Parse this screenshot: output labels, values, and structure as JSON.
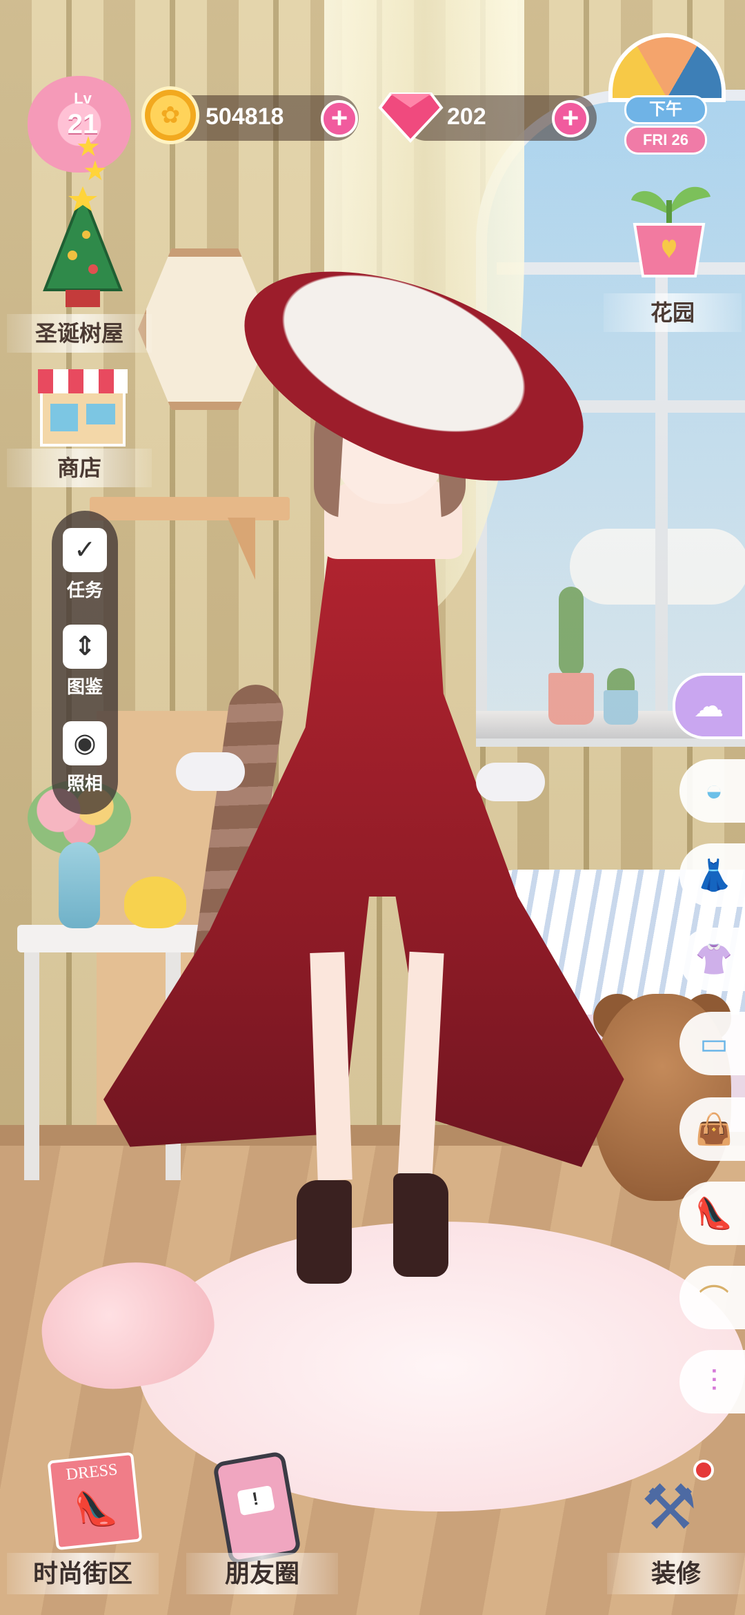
{
  "hud": {
    "level": {
      "label": "Lv",
      "value": "21"
    },
    "coins": {
      "value": "504818",
      "icon": "coin-icon",
      "add_label": "+"
    },
    "gems": {
      "value": "202",
      "icon": "diamond-icon",
      "add_label": "+"
    },
    "time_of_day": "下午",
    "date": "FRI 26"
  },
  "left_menu": {
    "christmas_house": "圣诞树屋",
    "shop": "商店"
  },
  "right_menu": {
    "garden": "花园"
  },
  "quick_bar": [
    {
      "label": "任务",
      "icon": "clipboard-icon"
    },
    {
      "label": "图鉴",
      "icon": "album-icon"
    },
    {
      "label": "照相",
      "icon": "camera-icon"
    }
  ],
  "category_tabs": [
    {
      "name": "hair",
      "icon": "hair-icon",
      "glyph": "☁"
    },
    {
      "name": "hat",
      "icon": "hat-icon",
      "glyph": "◒"
    },
    {
      "name": "dress",
      "icon": "dress-icon",
      "glyph": "👗"
    },
    {
      "name": "top",
      "icon": "shirt-icon",
      "glyph": "👚"
    },
    {
      "name": "bottom",
      "icon": "shorts-icon",
      "glyph": "▭"
    },
    {
      "name": "bag",
      "icon": "bag-icon",
      "glyph": "👜"
    },
    {
      "name": "shoes",
      "icon": "high-heel-icon",
      "glyph": "👠"
    },
    {
      "name": "necklace",
      "icon": "necklace-icon",
      "glyph": "⌒"
    },
    {
      "name": "earrings",
      "icon": "earrings-icon",
      "glyph": "⫶"
    }
  ],
  "bottom_bar": {
    "fashion_street": "时尚街区",
    "friends_circle": "朋友圈",
    "decorate": "装修",
    "dress_card_text": "DRESS",
    "phone_alert": "!"
  },
  "colors": {
    "accent_pink": "#f15b9e",
    "dress_red": "#9e1f2b",
    "active_tab": "#c9a6f0"
  }
}
